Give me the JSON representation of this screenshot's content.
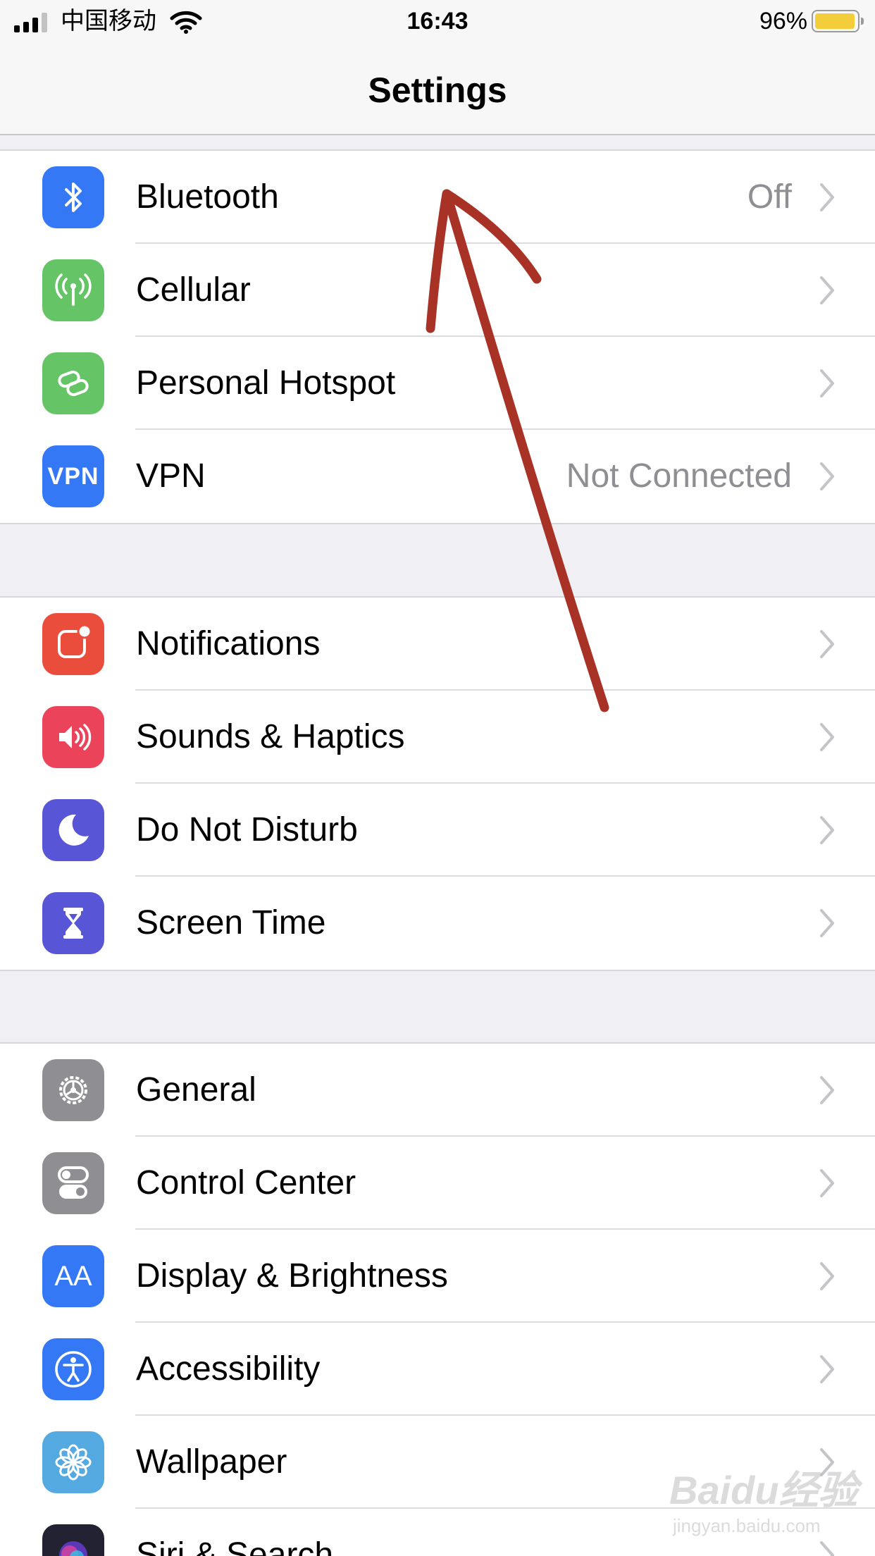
{
  "status_bar": {
    "carrier": "中国移动",
    "time": "16:43",
    "battery_percent": "96%",
    "battery_level": 0.96
  },
  "nav": {
    "title": "Settings"
  },
  "groups": [
    {
      "rows": [
        {
          "label": "Bluetooth",
          "value": "Off",
          "icon": "bluetooth-icon",
          "color": "#3478f6"
        },
        {
          "label": "Cellular",
          "value": "",
          "icon": "antenna-icon",
          "color": "#65c466"
        },
        {
          "label": "Personal Hotspot",
          "value": "",
          "icon": "hotspot-link-icon",
          "color": "#65c466"
        },
        {
          "label": "VPN",
          "value": "Not Connected",
          "icon": "vpn-icon",
          "icon_text": "VPN",
          "color": "#3478f6"
        }
      ]
    },
    {
      "rows": [
        {
          "label": "Notifications",
          "value": "",
          "icon": "notifications-icon",
          "color": "#eb4d3d"
        },
        {
          "label": "Sounds & Haptics",
          "value": "",
          "icon": "speaker-icon",
          "color": "#eb445a"
        },
        {
          "label": "Do Not Disturb",
          "value": "",
          "icon": "moon-icon",
          "color": "#5856d6"
        },
        {
          "label": "Screen Time",
          "value": "",
          "icon": "hourglass-icon",
          "color": "#5856d6"
        }
      ]
    },
    {
      "rows": [
        {
          "label": "General",
          "value": "",
          "icon": "gear-icon",
          "color": "#8e8e93"
        },
        {
          "label": "Control Center",
          "value": "",
          "icon": "toggles-icon",
          "color": "#8e8e93"
        },
        {
          "label": "Display & Brightness",
          "value": "",
          "icon": "text-size-icon",
          "icon_text": "AA",
          "color": "#3478f6"
        },
        {
          "label": "Accessibility",
          "value": "",
          "icon": "accessibility-icon",
          "color": "#3478f6"
        },
        {
          "label": "Wallpaper",
          "value": "",
          "icon": "flower-icon",
          "color": "#54a9e0"
        },
        {
          "label": "Siri & Search",
          "value": "",
          "icon": "siri-icon",
          "color": "#222233"
        }
      ]
    }
  ],
  "colors": {
    "annotation_arrow": "#a93226",
    "separator": "#dcdce0"
  },
  "watermark": {
    "logo": "Baidu经验",
    "url": "jingyan.baidu.com"
  }
}
